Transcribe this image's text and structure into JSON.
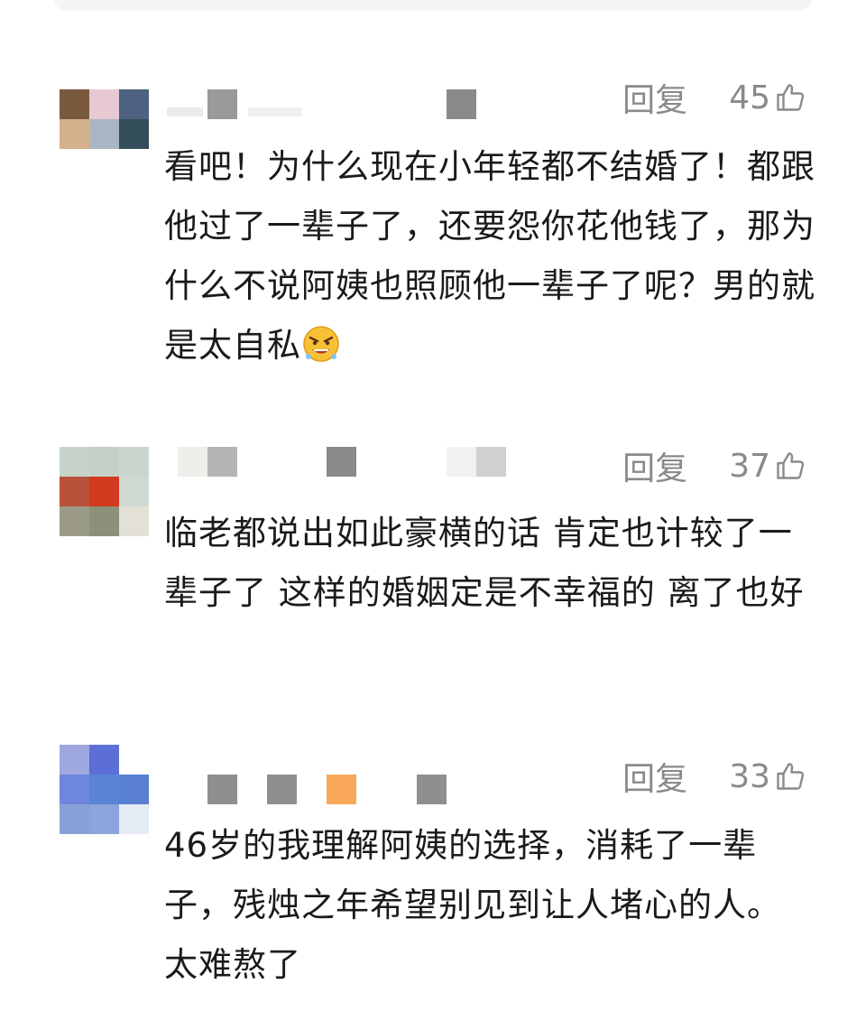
{
  "comments": [
    {
      "avatar_colors": [
        "#7a5a3f",
        "#e6c9d3",
        "#4d6180",
        "#d4b08c",
        "#a9b5c4",
        "#354f5a",
        "#ffffff",
        "#ffffff",
        "#ffffff"
      ],
      "name_blocks": [
        "#e9e9e9",
        "#9a9a9a",
        "#f0f0f0",
        "#8a8a8a"
      ],
      "reply_label": "回复",
      "likes": "45",
      "text": "看吧！为什么现在小年轻都不结婚了！都跟他过了一辈子了，还要怨你花他钱了，那为什么不说阿姨也照顾他一辈子了呢？男的就是太自私",
      "emoji": "angry-face-icon"
    },
    {
      "avatar_colors": [
        "#c8d3c9",
        "#c5d1c7",
        "#c9d6cd",
        "#b9523b",
        "#d13a1e",
        "#cfd9d1",
        "#9b9a86",
        "#8d9179",
        "#e3e0d6"
      ],
      "name_blocks": [
        "#eeeeea",
        "#b5b5b5",
        "#8a8a8a",
        "#f2f2f2",
        "#d0d0d0"
      ],
      "reply_label": "回复",
      "likes": "37",
      "text": "临老都说出如此豪横的话 肯定也计较了一辈子了 这样的婚姻定是不幸福的 离了也好"
    },
    {
      "avatar_colors": [
        "#9fa7e0",
        "#5c6fd6",
        "#ffffff",
        "#6f86dd",
        "#5b83d6",
        "#5a80d2",
        "#87a1d8",
        "#8ca4dc",
        "#e6ecf5"
      ],
      "name_blocks": [
        "#8f8f8f",
        "#8f8f8f",
        "#f9a85a",
        "#8f8f8f"
      ],
      "reply_label": "回复",
      "likes": "33",
      "text": "46岁的我理解阿姨的选择，消耗了一辈子，残烛之年希望别见到让人堵心的人。太难熬了"
    }
  ]
}
